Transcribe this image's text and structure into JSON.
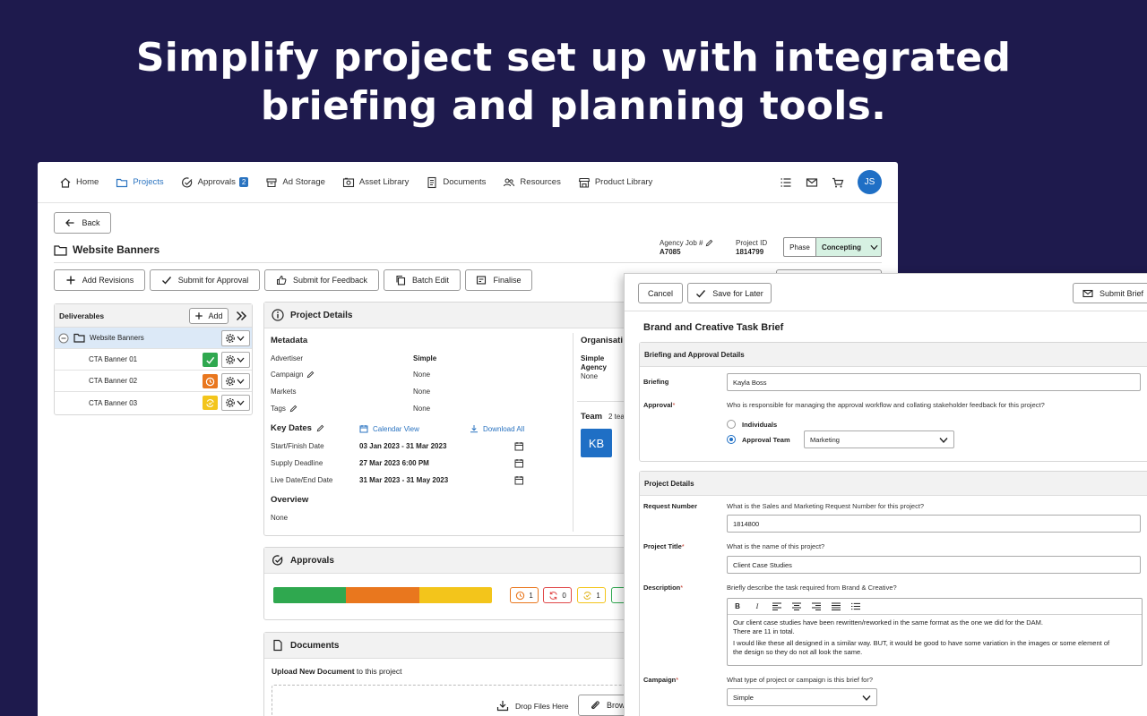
{
  "headline": {
    "line1": "Simplify project set up with integrated",
    "line2": "briefing and planning tools."
  },
  "nav": {
    "items": [
      {
        "label": "Home",
        "icon": "home-icon"
      },
      {
        "label": "Projects",
        "icon": "folder-icon",
        "active": true
      },
      {
        "label": "Approvals",
        "icon": "approvals-icon",
        "badge": "2"
      },
      {
        "label": "Ad Storage",
        "icon": "box-icon"
      },
      {
        "label": "Asset Library",
        "icon": "image-icon"
      },
      {
        "label": "Documents",
        "icon": "document-icon"
      },
      {
        "label": "Resources",
        "icon": "people-icon"
      },
      {
        "label": "Product Library",
        "icon": "store-icon"
      }
    ],
    "user_initials": "JS"
  },
  "page": {
    "back_label": "Back",
    "title": "Website Banners",
    "agency_job_label": "Agency Job #",
    "agency_job_value": "A7085",
    "project_id_label": "Project ID",
    "project_id_value": "1814799",
    "phase_label": "Phase",
    "phase_value": "Concepting"
  },
  "toolbar": {
    "add_revisions": "Add Revisions",
    "submit_approval": "Submit for Approval",
    "submit_feedback": "Submit for Feedback",
    "batch_edit": "Batch Edit",
    "finalise": "Finalise"
  },
  "deliverables": {
    "title": "Deliverables",
    "add_label": "Add",
    "root": "Website Banners",
    "items": [
      {
        "label": "CTA Banner 01",
        "status": "approved",
        "color": "#2fa84f"
      },
      {
        "label": "CTA Banner 02",
        "status": "pending",
        "color": "#e9771e"
      },
      {
        "label": "CTA Banner 03",
        "status": "in-review",
        "color": "#f3c51b"
      }
    ]
  },
  "project_details": {
    "title": "Project Details",
    "metadata_title": "Metadata",
    "advertiser_label": "Advertiser",
    "advertiser_value": "Simple",
    "campaign_label": "Campaign",
    "campaign_value": "None",
    "markets_label": "Markets",
    "markets_value": "None",
    "tags_label": "Tags",
    "tags_value": "None",
    "key_dates_title": "Key Dates",
    "calendar_view": "Calendar View",
    "download_all": "Download All",
    "start_label": "Start/Finish Date",
    "start_value": "03 Jan 2023 - 31 Mar 2023",
    "supply_label": "Supply Deadline",
    "supply_value": "27 Mar 2023 6:00 PM",
    "live_label": "Live Date/End Date",
    "live_value": "31 Mar 2023 - 31 May 2023",
    "overview_title": "Overview",
    "overview_value": "None",
    "org_title": "Organisati",
    "org_name": "Simple",
    "org_type": "Agency",
    "org_value": "None",
    "team_title": "Team",
    "team_count": "2 tea",
    "team_initials": "KB"
  },
  "approvals": {
    "title": "Approvals",
    "progress": {
      "approved": 0.333,
      "pending": 0.333,
      "in_review": 0.334
    },
    "counts": [
      {
        "value": "1",
        "color": "#e9771e"
      },
      {
        "value": "0",
        "color": "#e04848"
      },
      {
        "value": "1",
        "color": "#f3c51b"
      }
    ]
  },
  "documents": {
    "title": "Documents",
    "upload_bold": "Upload New Document",
    "upload_rest": " to this project",
    "drop_label": "Drop Files Here",
    "browse_label": "Brow"
  },
  "brief": {
    "cancel": "Cancel",
    "save_later": "Save for Later",
    "submit": "Submit Brief",
    "title": "Brand and Creative Task Brief",
    "sec1_title": "Briefing and Approval Details",
    "briefing_label": "Briefing",
    "briefing_value": "Kayla Boss",
    "approval_label": "Approval",
    "approval_question": "Who is responsible for managing the approval workflow and collating stakeholder feedback for this project?",
    "opt_individuals": "Individuals",
    "opt_team": "Approval Team",
    "team_select": "Marketing",
    "sec2_title": "Project Details",
    "request_label": "Request Number",
    "request_question": "What is the Sales and Marketing Request Number for this project?",
    "request_value": "1814800",
    "ptitle_label": "Project Title",
    "ptitle_question": "What is the name of this project?",
    "ptitle_value": "Client Case Studies",
    "desc_label": "Description",
    "desc_question": "Briefly describe the task required from Brand & Creative?",
    "desc_line1": "Our client case studies have been rewritten/reworked in the same format as the one we did for the DAM.",
    "desc_line2": "There are 11 in total.",
    "desc_line3": "I would like these all designed in a similar way. BUT, it would be good to have some variation in the images or some element of",
    "desc_line4": "the design so they do not all look the same.",
    "campaign_label": "Campaign",
    "campaign_question": "What type of project or campaign is this brief for?",
    "campaign_value": "Simple",
    "required_mark": "*",
    "toolbar_bold": "B",
    "toolbar_italic": "I"
  }
}
